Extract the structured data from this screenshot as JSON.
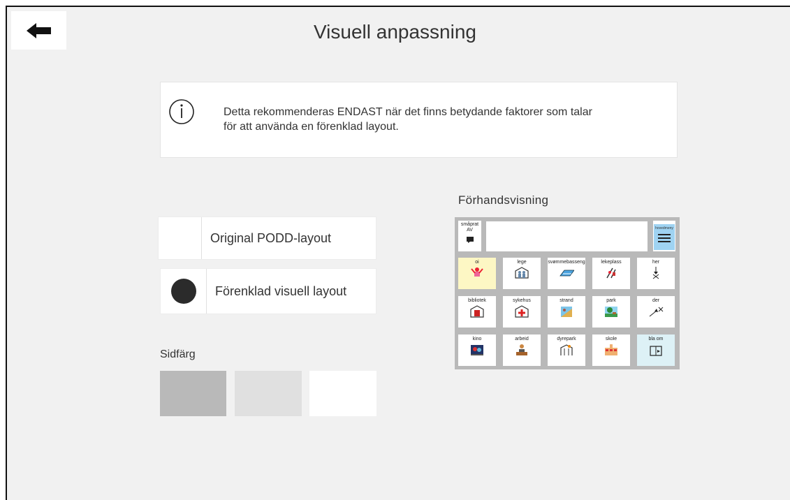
{
  "header": {
    "title": "Visuell anpassning"
  },
  "info": {
    "line1": "Detta rekommenderas ENDAST när det finns betydande faktorer som talar",
    "line2": "för att använda en förenklad layout."
  },
  "layout_options": [
    {
      "label": "Original PODD-layout",
      "selected": false
    },
    {
      "label": "Förenklad visuell layout",
      "selected": true
    }
  ],
  "page_color": {
    "label": "Sidfärg",
    "swatches": [
      "#b9b9b9",
      "#e0e0e0",
      "#ffffff"
    ]
  },
  "preview": {
    "label": "Förhandsvisning",
    "top_left": {
      "line1": "småprat",
      "line2": "AV"
    },
    "menu_label": "hovedmeny",
    "rows": [
      [
        {
          "label": "oi",
          "icon": "person-cheer-icon",
          "bg": "#fdf7c4"
        },
        {
          "label": "lege",
          "icon": "play-people-icon",
          "bg": "#ffffff"
        },
        {
          "label": "svømmebasseng",
          "icon": "pool-icon",
          "bg": "#ffffff"
        },
        {
          "label": "lekeplass",
          "icon": "playground-icon",
          "bg": "#ffffff"
        },
        {
          "label": "her",
          "icon": "here-arrow-icon",
          "bg": "#ffffff"
        }
      ],
      [
        {
          "label": "bibliotek",
          "icon": "library-icon",
          "bg": "#ffffff"
        },
        {
          "label": "sykehus",
          "icon": "hospital-icon",
          "bg": "#ffffff"
        },
        {
          "label": "strand",
          "icon": "beach-icon",
          "bg": "#ffffff"
        },
        {
          "label": "park",
          "icon": "park-icon",
          "bg": "#ffffff"
        },
        {
          "label": "der",
          "icon": "there-arrow-icon",
          "bg": "#ffffff"
        }
      ],
      [
        {
          "label": "kino",
          "icon": "cinema-icon",
          "bg": "#ffffff"
        },
        {
          "label": "arbeid",
          "icon": "work-icon",
          "bg": "#ffffff"
        },
        {
          "label": "dyrepark",
          "icon": "zoo-icon",
          "bg": "#ffffff"
        },
        {
          "label": "skole",
          "icon": "school-icon",
          "bg": "#ffffff"
        },
        {
          "label": "bla om",
          "icon": "page-turn-icon",
          "bg": "#ddf1f6"
        }
      ]
    ]
  }
}
